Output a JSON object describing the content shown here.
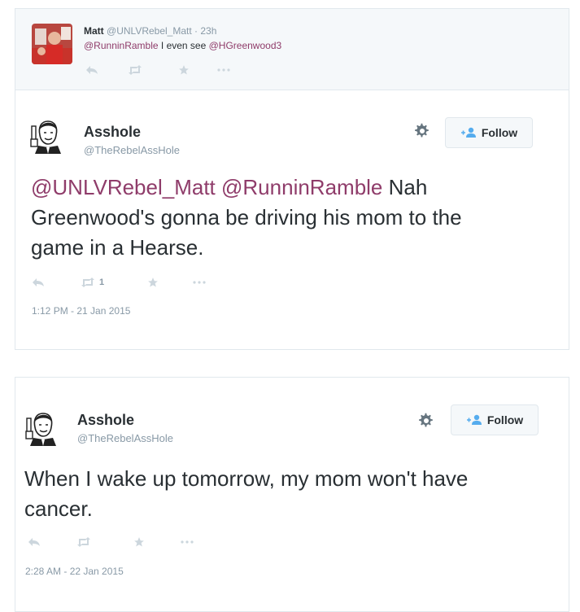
{
  "reply_tweet": {
    "name": "Matt",
    "handle": "@UNLVRebel_Matt",
    "time": "23h",
    "mention1": "@RunninRamble",
    "text_mid": " I even see ",
    "mention2": "@HGreenwood3"
  },
  "main_tweet": {
    "name": "Asshole",
    "handle": "@TheRebelAssHole",
    "follow_label": "Follow",
    "mention1": "@UNLVRebel_Matt",
    "mention2": "@RunninRamble",
    "text": " Nah Greenwood's gonna be driving his mom to the game in a Hearse.",
    "retweet_count": "1",
    "timestamp": "1:12 PM - 21 Jan 2015"
  },
  "second_tweet": {
    "name": "Asshole",
    "handle": "@TheRebelAssHole",
    "follow_label": "Follow",
    "text": "When I wake up tomorrow, my mom won't have cancer.",
    "timestamp": "2:28 AM - 22 Jan 2015"
  },
  "icons": {
    "reply": "reply-icon",
    "retweet": "retweet-icon",
    "favorite": "star-icon",
    "more": "more-icon",
    "settings": "gear-icon",
    "follow": "add-user-icon"
  },
  "colors": {
    "mention": "#8f3c6a",
    "muted": "#8899a6",
    "action_icon": "#ccd6dd",
    "border": "#e1e8ed"
  }
}
